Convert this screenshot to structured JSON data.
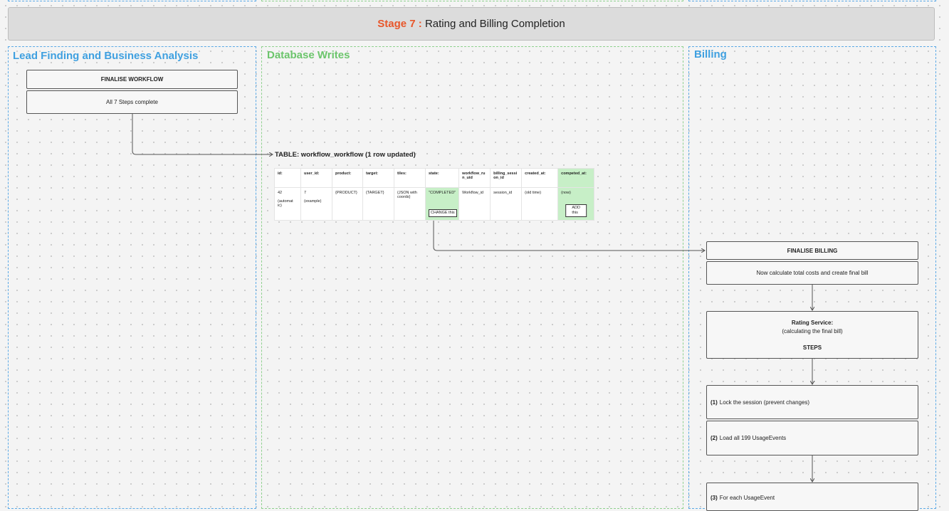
{
  "stage": {
    "number": "Stage 7",
    "separator": " : ",
    "title": "Rating and Billing Completion"
  },
  "lanes": {
    "lead": {
      "title": "Lead Finding and Business Analysis"
    },
    "db": {
      "title": "Database Writes"
    },
    "billing": {
      "title": "Billing"
    }
  },
  "lead_boxes": {
    "finalise": "FINALISE WORKFLOW",
    "complete": "All 7 Steps complete"
  },
  "table": {
    "title": "TABLE: workflow_workflow (1 row updated)",
    "headers": [
      "id:",
      "user_id:",
      "product:",
      "target:",
      "tiles:",
      "state:",
      "workflow_ru\nn_uid",
      "billing_sessi\non_id",
      "created_at:",
      "competed_at:"
    ],
    "row": [
      "42\n\n(automat\nic)",
      "7\n\n(example)",
      "{PRODUCT}",
      "{TARGET}",
      "{JSON with\ncoords}",
      "\"COMPLETED\"",
      "Workflow_id",
      "session_id",
      "(old time)",
      "(now)"
    ],
    "state_button": "CHANGE this",
    "completed_button": "ADD this"
  },
  "billing_boxes": {
    "finalise": "FINALISE BILLING",
    "calc": "Now calculate total costs and create final bill",
    "rating_title": "Rating Service:",
    "rating_sub": "(calculating the final bill)",
    "rating_steps": "STEPS",
    "step1_num": "(1)",
    "step1_text": "Lock the session (prevent changes)",
    "step2_num": "(2)",
    "step2_text": "Load all 199 UsageEvents",
    "step3_num": "(3)",
    "step3_text": "For each UsageEvent"
  },
  "colors": {
    "stage_accent": "#e8562a",
    "lane_blue": "#3fa0e0",
    "lane_green": "#6cc56c",
    "highlight": "#c7efc7"
  }
}
